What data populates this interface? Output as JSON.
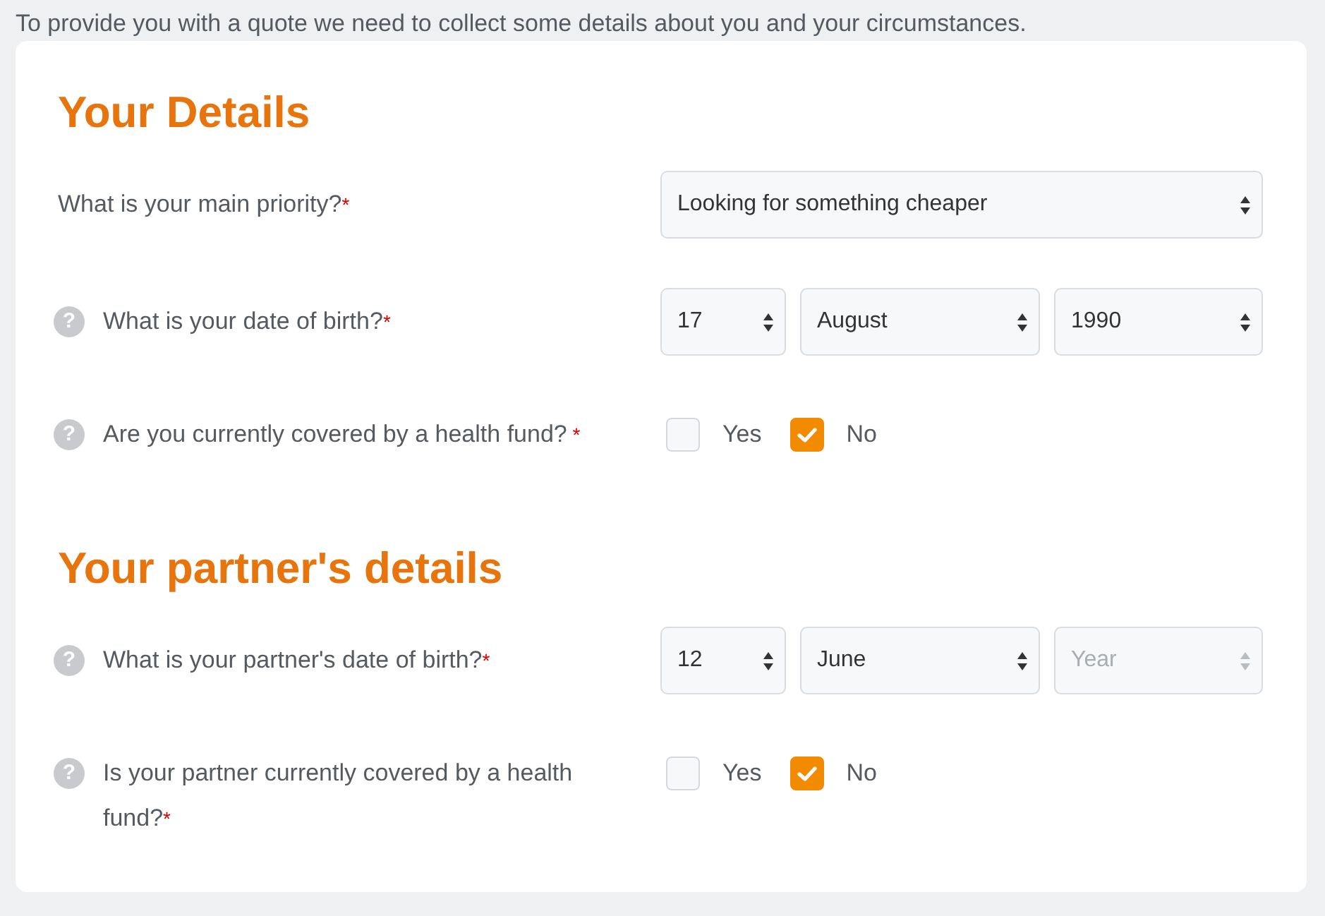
{
  "intro": "To provide you with a quote we need to collect some details about you and your circumstances.",
  "sections": [
    {
      "title": "Your Details",
      "fields": [
        {
          "kind": "select",
          "label": "What is your main priority?",
          "required_mark": "*",
          "selects": [
            {
              "value": "Looking for something cheaper"
            }
          ]
        },
        {
          "kind": "date",
          "help": "?",
          "label": "What is your date of birth?",
          "required_mark": "*",
          "selects": [
            {
              "value": "17"
            },
            {
              "value": "August"
            },
            {
              "value": "1990"
            }
          ]
        },
        {
          "kind": "choice",
          "help": "?",
          "label": "Are you currently covered by a health fund?",
          "required_mark": " *",
          "options": [
            {
              "label": "Yes",
              "checked": false
            },
            {
              "label": "No",
              "checked": true
            }
          ]
        }
      ]
    },
    {
      "title": "Your partner's details",
      "fields": [
        {
          "kind": "date",
          "help": "?",
          "label": "What is your partner's date of birth?",
          "required_mark": "*",
          "selects": [
            {
              "value": "12"
            },
            {
              "value": "June"
            },
            {
              "placeholder": "Year"
            }
          ]
        },
        {
          "kind": "choice",
          "help": "?",
          "label": "Is your partner currently covered by a health fund?",
          "required_mark": "*",
          "options": [
            {
              "label": "Yes",
              "checked": false
            },
            {
              "label": "No",
              "checked": true
            }
          ]
        }
      ]
    }
  ]
}
